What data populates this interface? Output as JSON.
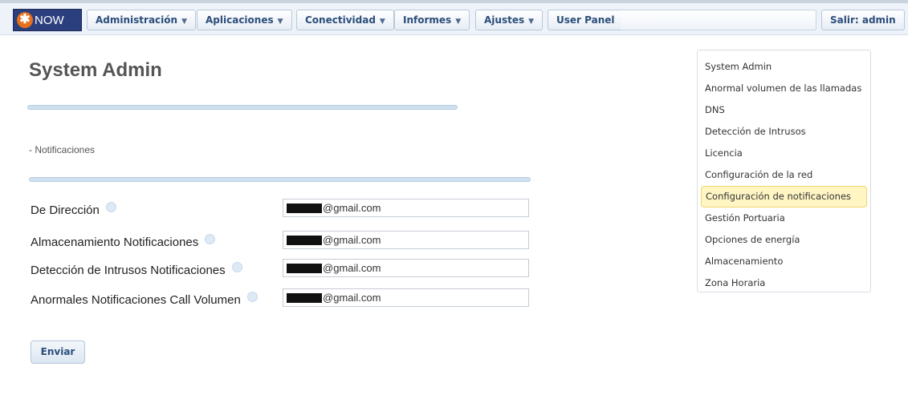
{
  "app": {
    "logo_text": "NOW",
    "logo_mark": "✱"
  },
  "nav": {
    "items": [
      {
        "label": "Administración",
        "has_menu": true
      },
      {
        "label": "Aplicaciones",
        "has_menu": true
      },
      {
        "label": "Conectividad",
        "has_menu": true
      },
      {
        "label": "Informes",
        "has_menu": true
      },
      {
        "label": "Ajustes",
        "has_menu": true
      },
      {
        "label": "User Panel",
        "has_menu": false
      }
    ],
    "logout_label": "Salir: admin",
    "caret": "▼"
  },
  "page": {
    "title": "System Admin",
    "section_title": "- Notificaciones"
  },
  "form": {
    "rows": [
      {
        "label": "De Dirección",
        "value": "@gmail.com"
      },
      {
        "label": "Almacenamiento Notificaciones",
        "value": "@gmail.com"
      },
      {
        "label": "Detección de Intrusos Notificaciones",
        "value": "@gmail.com"
      },
      {
        "label": "Anormales Notificaciones Call Volumen",
        "value": "@gmail.com"
      }
    ],
    "submit_label": "Enviar"
  },
  "sidebar": {
    "items": [
      {
        "label": "System Admin"
      },
      {
        "label": "Anormal volumen de las llamadas"
      },
      {
        "label": "DNS"
      },
      {
        "label": "Detección de Intrusos"
      },
      {
        "label": "Licencia"
      },
      {
        "label": "Configuración de la red"
      },
      {
        "label": "Configuración de notificaciones"
      },
      {
        "label": "Gestión Portuaria"
      },
      {
        "label": "Opciones de energía"
      },
      {
        "label": "Almacenamiento"
      },
      {
        "label": "Zona Horaria"
      }
    ],
    "active_index": 6
  },
  "colors": {
    "accent": "#2a4d7a",
    "logo_bg": "#2b3f7e",
    "logo_mark": "#e8701a",
    "active_item_bg": "#fff6c4"
  }
}
